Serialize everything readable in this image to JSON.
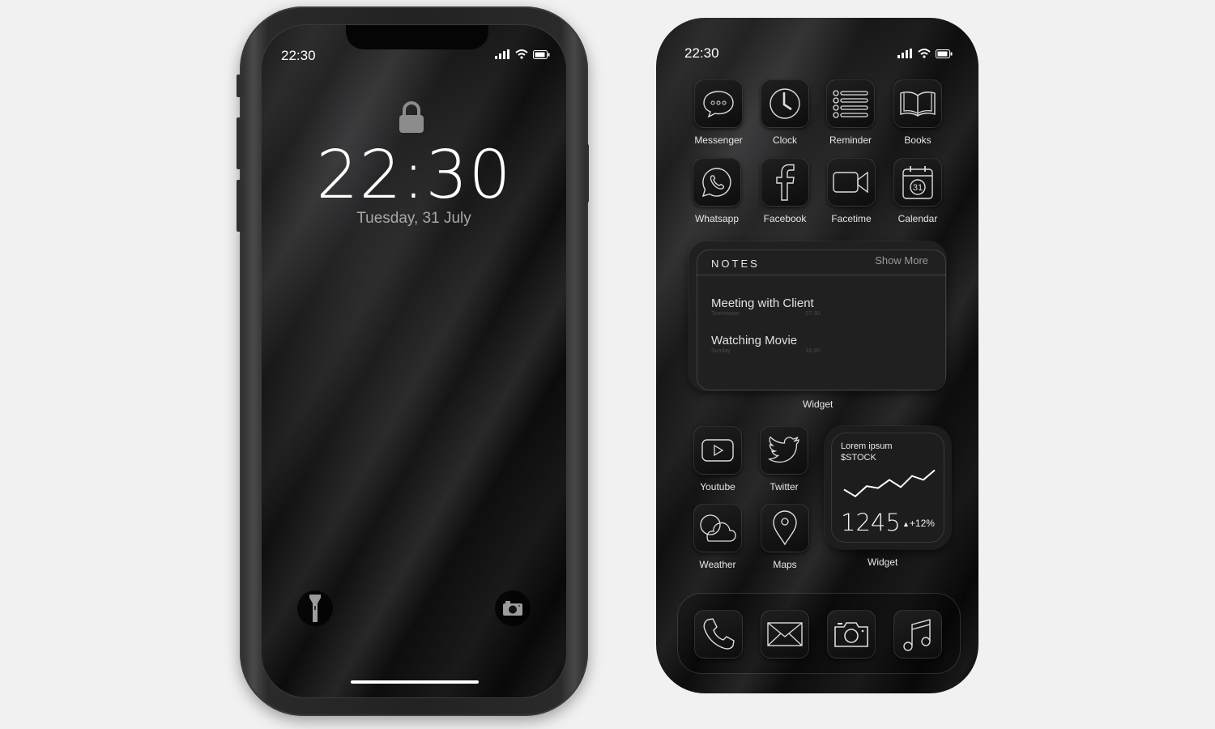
{
  "lock_screen": {
    "status_time": "22:30",
    "status_icons": [
      "signal-icon",
      "wifi-icon",
      "battery-icon"
    ],
    "lock_icon": "lock-icon",
    "time": "22:30",
    "date": "Tuesday, 31 July",
    "flashlight_icon": "flashlight-icon",
    "camera_icon": "camera-icon"
  },
  "home_screen": {
    "status_time": "22:30",
    "status_icons": [
      "signal-icon",
      "wifi-icon",
      "battery-icon"
    ],
    "apps_row1": [
      {
        "label": "Messenger",
        "icon": "messenger-icon"
      },
      {
        "label": "Clock",
        "icon": "clock-icon"
      },
      {
        "label": "Reminder",
        "icon": "reminder-icon"
      },
      {
        "label": "Books",
        "icon": "books-icon"
      }
    ],
    "apps_row2": [
      {
        "label": "Whatsapp",
        "icon": "whatsapp-icon"
      },
      {
        "label": "Facebook",
        "icon": "facebook-icon"
      },
      {
        "label": "Facetime",
        "icon": "facetime-icon"
      },
      {
        "label": "Calendar",
        "icon": "calendar-icon",
        "badge": "31"
      }
    ],
    "notes_widget": {
      "title": "NOTES",
      "show_more": "Show More",
      "notes": [
        {
          "title": "Meeting with Client",
          "day": "Tommorow",
          "time": "07.30"
        },
        {
          "title": "Watching Movie",
          "day": "Sunday",
          "time": "16.30"
        }
      ],
      "label": "Widget"
    },
    "apps_row3": [
      {
        "label": "Youtube",
        "icon": "youtube-icon"
      },
      {
        "label": "Twitter",
        "icon": "twitter-icon"
      }
    ],
    "apps_row4": [
      {
        "label": "Weather",
        "icon": "weather-icon"
      },
      {
        "label": "Maps",
        "icon": "maps-icon"
      }
    ],
    "stock_widget": {
      "line1": "Lorem ipsum",
      "line2": "$STOCK",
      "value": "1245",
      "change": "+12%",
      "trend": "up",
      "label": "Widget",
      "sparkline": [
        36,
        22,
        43,
        39,
        56,
        41,
        64,
        56,
        76
      ]
    },
    "dock": [
      {
        "icon": "phone-icon"
      },
      {
        "icon": "mail-icon"
      },
      {
        "icon": "camera-icon"
      },
      {
        "icon": "music-icon"
      }
    ]
  }
}
